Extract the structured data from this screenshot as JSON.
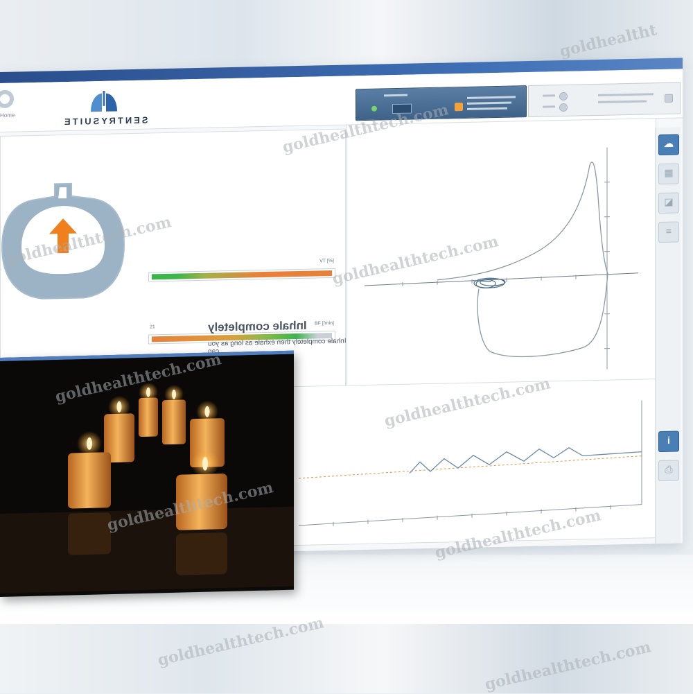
{
  "watermark": "goldhealthtech.com",
  "watermark_top_right": "goldhealtht",
  "app": {
    "brand": "SENTRYSUITE",
    "home_label": "Home"
  },
  "coach": {
    "bar1_label": "VT [%]",
    "bar2_label": "BF [/min]",
    "bar2_tick": "21",
    "bar1_level": 0.15,
    "bar2_level": 0.6,
    "instruction_title": "Inhale completely",
    "instruction_text": "Inhale completely then exhale as long as you can"
  },
  "colors": {
    "accent": "#4a7fb5",
    "arrow": "#f07f1e",
    "lung": "#9cb3c6",
    "bar_green": "#3cb54a",
    "bar_orange": "#e8803a",
    "curve": "#8a98a4"
  },
  "icons": {
    "home": "home-icon",
    "lungs": "lungs-icon",
    "arrow": "arrow-up-icon",
    "warning": "warning-icon",
    "info": "info-icon"
  }
}
